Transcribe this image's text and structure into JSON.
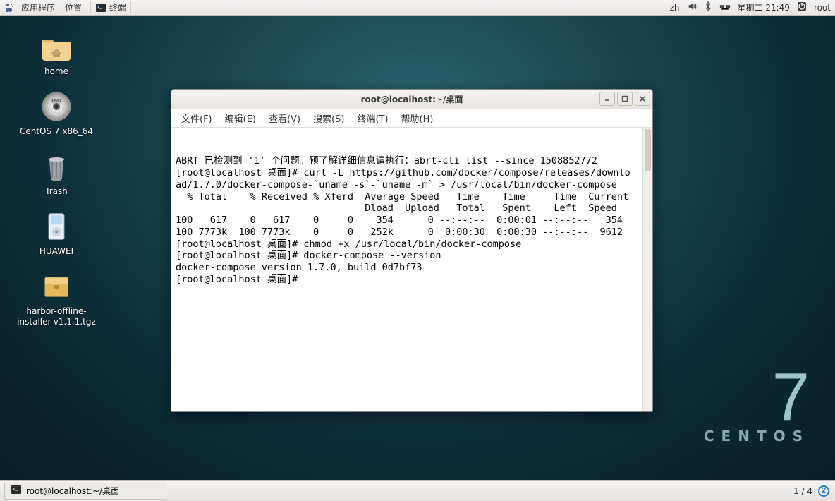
{
  "top_panel": {
    "apps_label": "应用程序",
    "places_label": "位置",
    "task_label": "终端",
    "ime": "zh",
    "day_time": "星期二  21:49",
    "user": "root"
  },
  "desktop_icons": {
    "home": "home",
    "cd": "CentOS 7 x86_64",
    "trash": "Trash",
    "huawei": "HUAWEI",
    "harbor": "harbor-offline-installer-v1.1.1.tgz"
  },
  "brand": {
    "seven": "7",
    "name": "CENTOS"
  },
  "terminal": {
    "title": "root@localhost:~/桌面",
    "menus": {
      "file": "文件(F)",
      "edit": "编辑(E)",
      "view": "查看(V)",
      "search": "搜索(S)",
      "terminal": "终端(T)",
      "help": "帮助(H)"
    },
    "lines": [
      "ABRT 已检测到 '1' 个问题。预了解详细信息请执行：abrt-cli list --since 1508852772",
      "[root@localhost 桌面]# curl -L https://github.com/docker/compose/releases/downlo",
      "ad/1.7.0/docker-compose-`uname -s`-`uname -m` > /usr/local/bin/docker-compose",
      "  % Total    % Received % Xferd  Average Speed   Time    Time     Time  Current",
      "                                 Dload  Upload   Total   Spent    Left  Speed",
      "100   617    0   617    0     0    354      0 --:--:--  0:00:01 --:--:--   354",
      "100 7773k  100 7773k    0     0   252k      0  0:00:30  0:00:30 --:--:--  9612",
      "[root@localhost 桌面]# chmod +x /usr/local/bin/docker-compose",
      "[root@localhost 桌面]# docker-compose --version",
      "docker-compose version 1.7.0, build 0d7bf73",
      "[root@localhost 桌面]# "
    ]
  },
  "bottom_panel": {
    "task": "root@localhost:~/桌面",
    "ws": "1 / 4"
  }
}
